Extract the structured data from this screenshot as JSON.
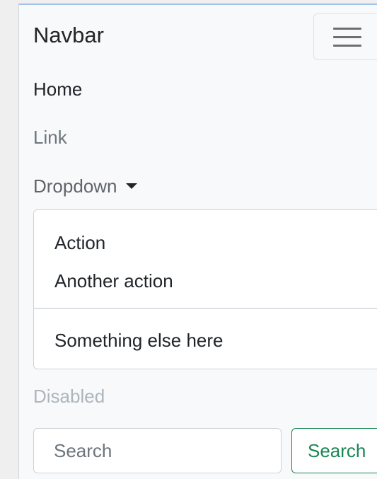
{
  "navbar": {
    "brand": "Navbar",
    "toggler_icon": "hamburger-icon",
    "links": {
      "home": "Home",
      "link": "Link",
      "dropdown": "Dropdown",
      "disabled": "Disabled"
    },
    "dropdown_menu": {
      "items": [
        "Action",
        "Another action",
        "Something else here"
      ]
    },
    "search": {
      "placeholder": "Search",
      "button_label": "Search"
    }
  },
  "colors": {
    "background": "#f8f9fa",
    "text": "#212529",
    "muted": "#6c757d",
    "disabled": "#adb5bd",
    "success": "#198754"
  }
}
